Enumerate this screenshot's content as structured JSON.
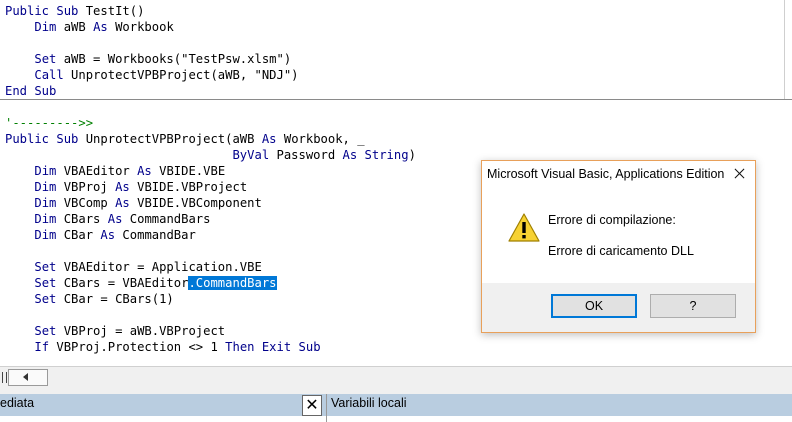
{
  "editor": {
    "lines": [
      {
        "parts": [
          {
            "t": "Public Sub ",
            "c": "kw"
          },
          {
            "t": "TestIt()",
            "c": ""
          }
        ]
      },
      {
        "parts": [
          {
            "t": "    ",
            "c": ""
          },
          {
            "t": "Dim",
            "c": "kw"
          },
          {
            "t": " aWB ",
            "c": ""
          },
          {
            "t": "As",
            "c": "kw"
          },
          {
            "t": " Workbook",
            "c": ""
          }
        ]
      },
      {
        "parts": []
      },
      {
        "parts": [
          {
            "t": "    ",
            "c": ""
          },
          {
            "t": "Set",
            "c": "kw"
          },
          {
            "t": " aWB = Workbooks(\"TestPsw.xlsm\")",
            "c": ""
          }
        ]
      },
      {
        "parts": [
          {
            "t": "    ",
            "c": ""
          },
          {
            "t": "Call",
            "c": "kw"
          },
          {
            "t": " UnprotectVPBProject(aWB, \"NDJ\")",
            "c": ""
          }
        ]
      },
      {
        "parts": [
          {
            "t": "End Sub",
            "c": "kw"
          }
        ]
      },
      {
        "parts": []
      },
      {
        "parts": [
          {
            "t": "'--------->>",
            "c": "cm"
          }
        ]
      },
      {
        "parts": [
          {
            "t": "Public Sub ",
            "c": "kw"
          },
          {
            "t": "UnprotectVPBProject(aWB ",
            "c": ""
          },
          {
            "t": "As",
            "c": "kw"
          },
          {
            "t": " Workbook, _",
            "c": ""
          }
        ]
      },
      {
        "parts": [
          {
            "t": "                               ",
            "c": ""
          },
          {
            "t": "ByVal",
            "c": "kw"
          },
          {
            "t": " Password ",
            "c": ""
          },
          {
            "t": "As String",
            "c": "kw"
          },
          {
            "t": ")",
            "c": ""
          }
        ]
      },
      {
        "parts": [
          {
            "t": "    ",
            "c": ""
          },
          {
            "t": "Dim",
            "c": "kw"
          },
          {
            "t": " VBAEditor ",
            "c": ""
          },
          {
            "t": "As",
            "c": "kw"
          },
          {
            "t": " VBIDE.VBE",
            "c": ""
          }
        ]
      },
      {
        "parts": [
          {
            "t": "    ",
            "c": ""
          },
          {
            "t": "Dim",
            "c": "kw"
          },
          {
            "t": " VBProj ",
            "c": ""
          },
          {
            "t": "As",
            "c": "kw"
          },
          {
            "t": " VBIDE.VBProject",
            "c": ""
          }
        ]
      },
      {
        "parts": [
          {
            "t": "    ",
            "c": ""
          },
          {
            "t": "Dim",
            "c": "kw"
          },
          {
            "t": " VBComp ",
            "c": ""
          },
          {
            "t": "As",
            "c": "kw"
          },
          {
            "t": " VBIDE.VBComponent",
            "c": ""
          }
        ]
      },
      {
        "parts": [
          {
            "t": "    ",
            "c": ""
          },
          {
            "t": "Dim",
            "c": "kw"
          },
          {
            "t": " CBars ",
            "c": ""
          },
          {
            "t": "As",
            "c": "kw"
          },
          {
            "t": " CommandBars",
            "c": ""
          }
        ]
      },
      {
        "parts": [
          {
            "t": "    ",
            "c": ""
          },
          {
            "t": "Dim",
            "c": "kw"
          },
          {
            "t": " CBar ",
            "c": ""
          },
          {
            "t": "As",
            "c": "kw"
          },
          {
            "t": " CommandBar",
            "c": ""
          }
        ]
      },
      {
        "parts": []
      },
      {
        "parts": [
          {
            "t": "    ",
            "c": ""
          },
          {
            "t": "Set",
            "c": "kw"
          },
          {
            "t": " VBAEditor = Application.VBE",
            "c": ""
          }
        ]
      },
      {
        "parts": [
          {
            "t": "    ",
            "c": ""
          },
          {
            "t": "Set",
            "c": "kw"
          },
          {
            "t": " CBars = VBAEditor",
            "c": ""
          },
          {
            "t": ".CommandBars",
            "c": "sel"
          }
        ]
      },
      {
        "parts": [
          {
            "t": "    ",
            "c": ""
          },
          {
            "t": "Set",
            "c": "kw"
          },
          {
            "t": " CBar = CBars(1)",
            "c": ""
          }
        ]
      },
      {
        "parts": []
      },
      {
        "parts": [
          {
            "t": "    ",
            "c": ""
          },
          {
            "t": "Set",
            "c": "kw"
          },
          {
            "t": " VBProj = aWB.VBProject",
            "c": ""
          }
        ]
      },
      {
        "parts": [
          {
            "t": "    ",
            "c": ""
          },
          {
            "t": "If",
            "c": "kw"
          },
          {
            "t": " VBProj.Protection <> 1 ",
            "c": ""
          },
          {
            "t": "Then Exit Sub",
            "c": "kw"
          }
        ]
      }
    ]
  },
  "panes": {
    "immediate_title": "ediata",
    "close_symbol": "✕",
    "locals_title": "Variabili locali"
  },
  "dialog": {
    "title": "Microsoft Visual Basic, Applications Edition",
    "message_line1": "Errore di compilazione:",
    "message_line2": "Errore di caricamento DLL",
    "ok_label": "OK",
    "help_label": "?",
    "icon": "warning-icon"
  },
  "colors": {
    "keyword": "#00008b",
    "comment": "#008000",
    "selection": "#0078d7",
    "pane_header": "#b9cde0",
    "dialog_border": "#e8a05a"
  }
}
